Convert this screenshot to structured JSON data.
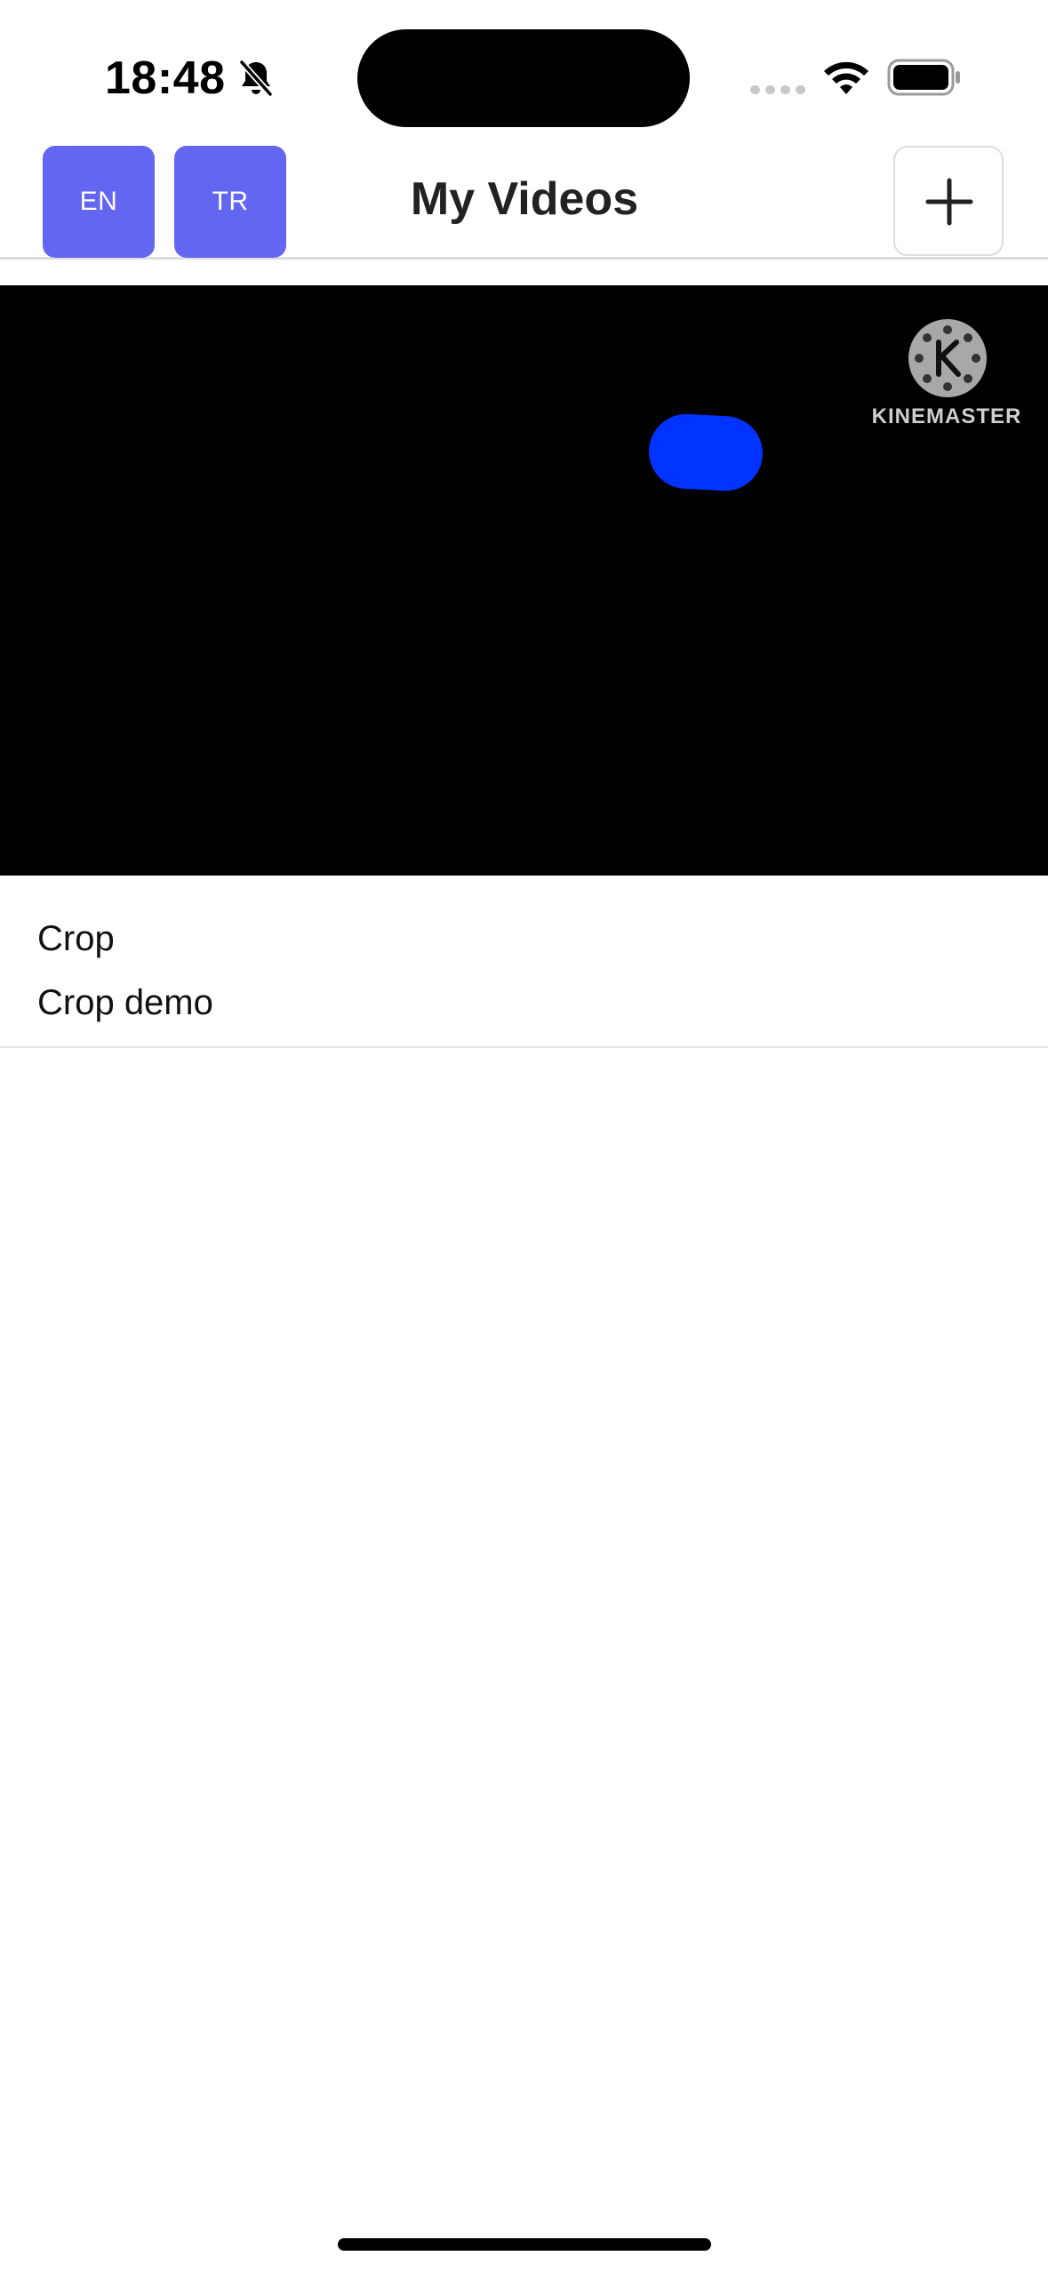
{
  "status_bar": {
    "time": "18:48",
    "icons": [
      "bell-slash-icon",
      "cellular-signal-icon",
      "wifi-icon",
      "battery-icon"
    ]
  },
  "header": {
    "lang_buttons": [
      {
        "label": "EN"
      },
      {
        "label": "TR"
      }
    ],
    "title": "My Videos",
    "add_icon": "plus-icon",
    "accent_color": "#6366f1"
  },
  "video": {
    "background_color": "#000000",
    "watermark": "KINEMASTER",
    "title": "Crop",
    "description": "Crop demo"
  }
}
